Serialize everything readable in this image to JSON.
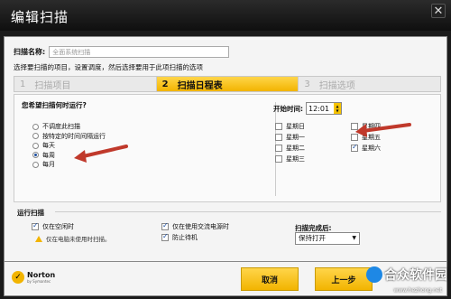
{
  "window": {
    "title": "编辑扫描",
    "close_glyph": "✕"
  },
  "scan_name": {
    "label": "扫描名称:",
    "value": "全面系统扫描"
  },
  "description": "选择要扫描的项目，设置调度，然后选择要用于此项扫描的选项",
  "steps": [
    {
      "num": "1",
      "label": "扫描项目",
      "active": false
    },
    {
      "num": "2",
      "label": "扫描日程表",
      "active": true
    },
    {
      "num": "3",
      "label": "扫描选项",
      "active": false
    }
  ],
  "schedule": {
    "title": "您希望扫描何时运行?",
    "options": [
      {
        "label": "不调度此扫描",
        "selected": false
      },
      {
        "label": "按特定的时间间隔运行",
        "selected": false
      },
      {
        "label": "每天",
        "selected": false
      },
      {
        "label": "每周",
        "selected": true
      },
      {
        "label": "每月",
        "selected": false
      }
    ]
  },
  "start_time": {
    "label": "开始时间:",
    "value": "12:01"
  },
  "days": [
    {
      "label": "星期日",
      "checked": false
    },
    {
      "label": "星期一",
      "checked": false
    },
    {
      "label": "星期二",
      "checked": false
    },
    {
      "label": "星期三",
      "checked": false
    },
    {
      "label": "星期四",
      "checked": false
    },
    {
      "label": "星期五",
      "checked": false
    },
    {
      "label": "星期六",
      "checked": true
    }
  ],
  "run_scan": {
    "title": "运行扫描",
    "idle": {
      "label": "仅在空闲时",
      "checked": true
    },
    "idle_note": "仅在电脑未使用时扫描。",
    "ac_power": {
      "label": "仅在使用交流电源时",
      "checked": true
    },
    "prevent_standby": {
      "label": "防止待机",
      "checked": true
    }
  },
  "after_scan": {
    "label": "扫描完成后:",
    "value": "保持打开"
  },
  "buttons": {
    "cancel": "取消",
    "prev": "上一步"
  },
  "brand": {
    "name": "Norton",
    "sub": "by Symantec"
  },
  "watermark": {
    "text": "合众软件园",
    "url": "www.hezhong.net"
  },
  "colors": {
    "accent": "#f2b400",
    "arrow": "#c0392b"
  }
}
